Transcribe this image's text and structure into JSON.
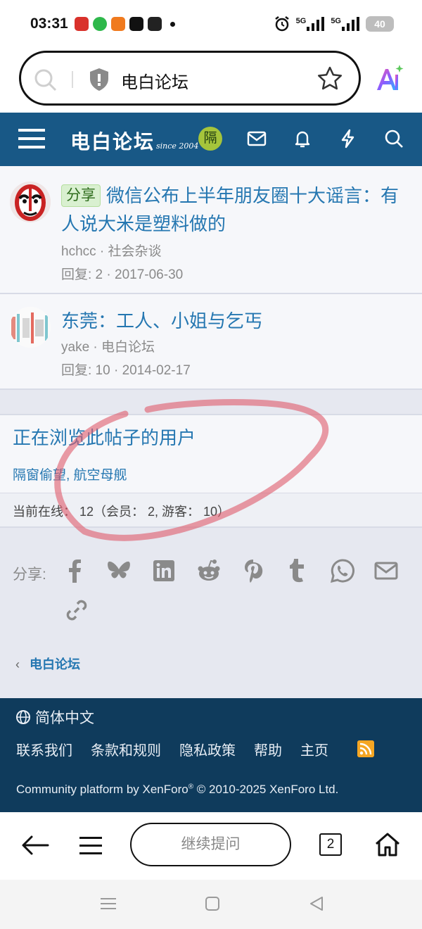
{
  "status_bar": {
    "time": "03:31",
    "network_1": "5G",
    "network_2": "5G",
    "battery": "40"
  },
  "browser": {
    "url_text": "电白论坛",
    "ask_label": "继续提问",
    "tab_count": "2"
  },
  "forum_header": {
    "logo_text": "电白论坛",
    "logo_since": "since 2004",
    "user_avatar_char": "隔"
  },
  "threads": [
    {
      "tag": "分享",
      "title": "微信公布上半年朋友圈十大谣言：有人说大米是塑料做的",
      "author_forum": "hchcc · 社会杂谈",
      "stats": "回复: 2 · 2017-06-30"
    },
    {
      "tag": "",
      "title": "东莞：工人、小姐与乞丐",
      "author_forum": "yake · 电白论坛",
      "stats": "回复: 10 · 2014-02-17"
    }
  ],
  "viewers": {
    "title": "正在浏览此帖子的用户",
    "users": "隔窗偷望, 航空母舰"
  },
  "online": {
    "text": "当前在线： 12（会员： 2, 游客： 10）"
  },
  "share": {
    "label": "分享:",
    "icons": [
      "facebook-icon",
      "bluesky-icon",
      "linkedin-icon",
      "reddit-icon",
      "pinterest-icon",
      "tumblr-icon",
      "whatsapp-icon",
      "email-icon",
      "link-icon"
    ]
  },
  "breadcrumb": {
    "label": "电白论坛"
  },
  "footer": {
    "language": "简体中文",
    "links": [
      "联系我们",
      "条款和规则",
      "隐私政策",
      "帮助",
      "主页"
    ],
    "copyright_prefix": "Community platform by XenForo",
    "copyright_reg": "®",
    "copyright_suffix": " © 2010-2025 XenForo Ltd."
  },
  "colors": {
    "header_bg": "#185886",
    "footer_bg": "#0f3b5c",
    "link": "#2577b1",
    "annotation": "#e05a6a"
  }
}
